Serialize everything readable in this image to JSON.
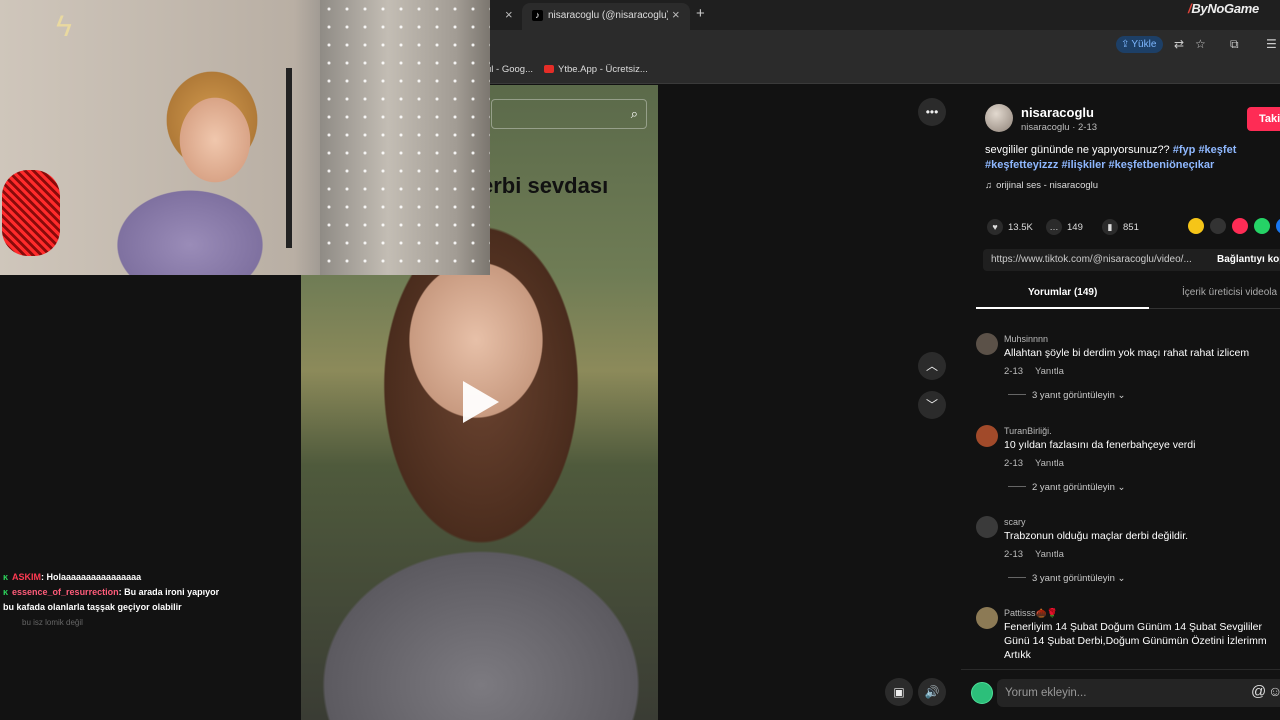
{
  "browser": {
    "tab_title": "nisaracoglu (@nisaracoglu) | Ti",
    "tab_favicon": "tiktok-icon",
    "close_glyph": "×",
    "new_tab_glyph": "+",
    "brand": "ByNoGame",
    "brand_slash": "/",
    "upload_label": "Yükle",
    "bookmarks": [
      "ul - Goog...",
      "Ytbe.App - Ücretsiz..."
    ]
  },
  "video": {
    "caption": "erbi sevdası",
    "controls": [
      "more-options-icon",
      "previous-video-icon",
      "next-video-icon",
      "picture-in-picture-icon",
      "volume-icon"
    ]
  },
  "chat": [
    {
      "user": "ASKIM",
      "text": ": Holaaaaaaaaaaaaaaaa"
    },
    {
      "user": "essence_of_resurrection",
      "text": ": Bu arada ironi yapıyor"
    },
    {
      "text": "bu kafada olanlarla taşşak geçiyor olabilir"
    },
    {
      "text": "bu isz lomik değil"
    }
  ],
  "post": {
    "username": "nisaracoglu",
    "subline": "nisaracoglu · 2-13",
    "follow_label": "Takip",
    "description_text": "sevgililer gününde ne yapıyorsunuz??",
    "hashtags": [
      "#fyp",
      "#keşfet",
      "#keşfetteyizzz",
      "#ilişkiler",
      "#keşfetbeniöneçıkar"
    ],
    "sound": "orijinal ses - nisaracoglu",
    "likes": "13.5K",
    "comments": "149",
    "saves": "851",
    "link": "https://www.tiktok.com/@nisaracoglu/video/...",
    "copy_link_label": "Bağlantıyı kop",
    "tab_comments": "Yorumlar (149)",
    "tab_creator": "İçerik üreticisi videola"
  },
  "comments": [
    {
      "user": "Muhsinnnn",
      "text": "Allahtan şöyle bi derdim yok maçı rahat rahat izlicem",
      "date": "2-13",
      "reply": "Yanıtla",
      "more": "3 yanıt görüntüleyin ⌄"
    },
    {
      "user": "TuranBirliği.",
      "text": "10 yıldan fazlasını da fenerbahçeye verdi",
      "date": "2-13",
      "reply": "Yanıtla",
      "more": "2 yanıt görüntüleyin ⌄"
    },
    {
      "user": "scary",
      "text": "Trabzonun olduğu maçlar derbi değildir.",
      "date": "2-13",
      "reply": "Yanıtla",
      "more": "3 yanıt görüntüleyin ⌄"
    },
    {
      "user": "Pattisss🌰🌹",
      "text": "Fenerliyim 14 Şubat Doğum Günüm 14 Şubat Sevgililer Günü 14 Şubat Derbi,Doğum Günümün Özetini İzlerimm Artıkk"
    }
  ],
  "comment_input": {
    "placeholder": "Yorum ekleyin..."
  },
  "colors": {
    "accent": "#fe2c55",
    "hashtag": "#8fb8ff",
    "background": "#121212"
  }
}
